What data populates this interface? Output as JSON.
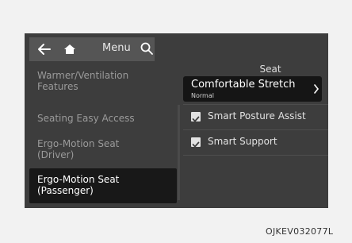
{
  "topbar": {
    "back_icon": "back-arrow-icon",
    "home_icon": "home-icon",
    "menu_label": "Menu",
    "search_icon": "search-icon"
  },
  "panel_title": "Seat",
  "left_menu": [
    {
      "label_line1": "Warmer/Ventilation",
      "label_line2": "Features",
      "selected": false
    },
    {
      "label_line1": "Seating Easy Access",
      "label_line2": "",
      "selected": false
    },
    {
      "label_line1": "Ergo-Motion Seat",
      "label_line2": "(Driver)",
      "selected": false
    },
    {
      "label_line1": "Ergo-Motion Seat",
      "label_line2": "(Passenger)",
      "selected": true
    }
  ],
  "settings": {
    "comfortable_stretch": {
      "label": "Comfortable Stretch",
      "value": "Normal",
      "icon": "chevron-right-icon"
    },
    "smart_posture": {
      "label": "Smart Posture Assist",
      "checked": true
    },
    "smart_support": {
      "label": "Smart Support",
      "checked": true
    }
  },
  "image_code": "OJKEV032077L",
  "colors": {
    "screen_bg": "#3d3d3d",
    "selected_bg": "#181818",
    "text_dim": "#9a9a9a",
    "text_bright": "#ffffff"
  }
}
